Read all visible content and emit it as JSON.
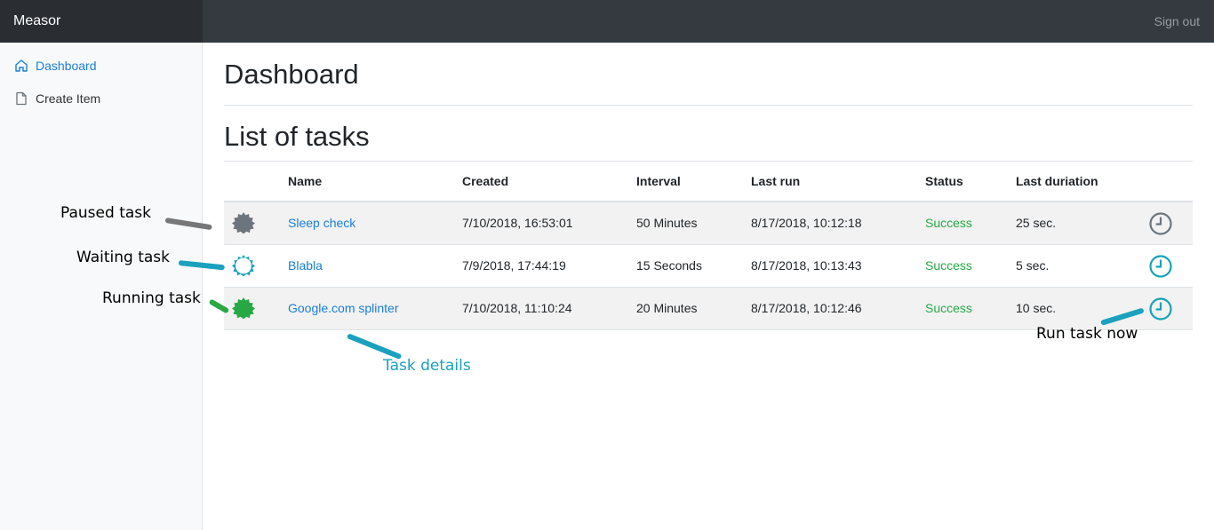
{
  "app": {
    "brand": "Measor",
    "signout": "Sign out"
  },
  "sidebar": {
    "items": [
      {
        "label": "Dashboard",
        "icon": "home-icon",
        "active": true
      },
      {
        "label": "Create Item",
        "icon": "file-icon",
        "active": false
      }
    ]
  },
  "main": {
    "title": "Dashboard",
    "section_title": "List of tasks"
  },
  "table": {
    "columns": [
      "Name",
      "Created",
      "Interval",
      "Last run",
      "Status",
      "Last duriation"
    ],
    "rows": [
      {
        "state": "paused",
        "state_icon": "paused-gear-icon",
        "state_color": "#6c757d",
        "name": "Sleep check",
        "created": "7/10/2018, 16:53:01",
        "interval": "50 Minutes",
        "last_run": "8/17/2018, 10:12:18",
        "status": "Success",
        "duration": "25 sec.",
        "run_icon": "clock-icon",
        "run_color": "#6c757d"
      },
      {
        "state": "waiting",
        "state_icon": "waiting-gear-icon",
        "state_color": "#17a2b8",
        "name": "Blabla",
        "created": "7/9/2018, 17:44:19",
        "interval": "15 Seconds",
        "last_run": "8/17/2018, 10:13:43",
        "status": "Success",
        "duration": "5 sec.",
        "run_icon": "clock-icon",
        "run_color": "#17a2b8"
      },
      {
        "state": "running",
        "state_icon": "running-gear-icon",
        "state_color": "#28a745",
        "name": "Google.com splinter",
        "created": "7/10/2018, 11:10:24",
        "interval": "20 Minutes",
        "last_run": "8/17/2018, 10:12:46",
        "status": "Success",
        "duration": "10 sec.",
        "run_icon": "clock-icon",
        "run_color": "#17a2b8"
      }
    ]
  },
  "annotations": {
    "paused": "Paused task",
    "waiting": "Waiting task",
    "running": "Running task",
    "details": "Task details",
    "run_now": "Run task now"
  },
  "colors": {
    "link": "#1a7ed8",
    "success": "#28a745",
    "teal": "#17a2b8",
    "gray": "#6c757d",
    "topbar": "#343a40"
  }
}
